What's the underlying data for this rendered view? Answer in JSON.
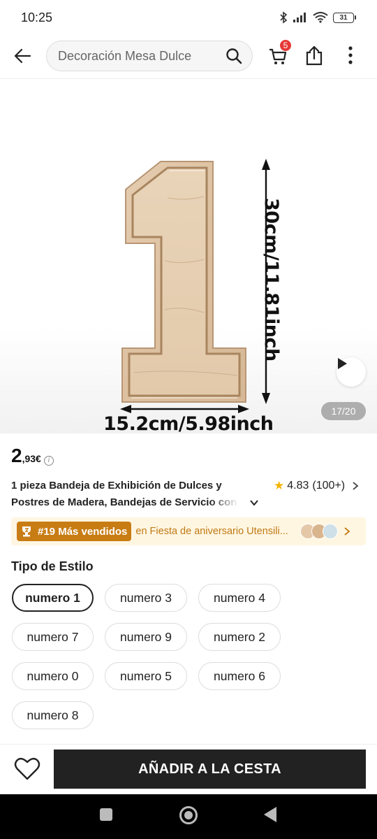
{
  "status_bar": {
    "time": "10:25",
    "battery": "31"
  },
  "header": {
    "search_text": "Decoración Mesa Dulce",
    "cart_count": "5"
  },
  "product": {
    "image_counter": "17/20",
    "dimension_width": "15.2cm/5.98inch",
    "dimension_height": "30cm/11.81inch",
    "price_int": "2",
    "price_dec": ",93€",
    "title_line1": "1 pieza Bandeja de Exhibición de Dulces y",
    "title_line2": "Postres de Madera, Bandejas de Servicio con",
    "rating": "4.83",
    "rating_count": "(100+)"
  },
  "bestseller": {
    "badge": "#19 Más vendidos",
    "text": "en Fiesta de aniversario Utensili..."
  },
  "style_section": {
    "title": "Tipo de Estilo",
    "options": [
      "numero 1",
      "numero 3",
      "numero 4",
      "numero 7",
      "numero 9",
      "numero 2",
      "numero 0",
      "numero 5",
      "numero 6",
      "numero 8"
    ],
    "selected": "numero 1"
  },
  "bottom_bar": {
    "add_to_cart": "AÑADIR A LA CESTA"
  },
  "colors": {
    "accent_dark": "#222222",
    "badge_red": "#e53935",
    "bestseller_bg": "#fff6e2",
    "bestseller_badge": "#c87d14",
    "star": "#f5b400"
  }
}
